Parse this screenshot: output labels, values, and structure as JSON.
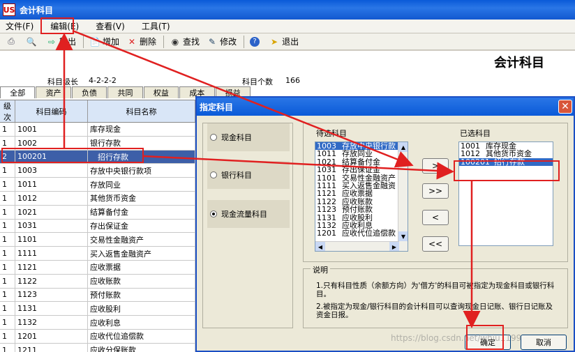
{
  "app": {
    "logo": "US",
    "title": "会计科目"
  },
  "menu": [
    "文件(F)",
    "编辑(E)",
    "查看(V)",
    "工具(T)"
  ],
  "toolbar": [
    {
      "icon": "print-icon",
      "label": ""
    },
    {
      "icon": "preview-icon",
      "label": ""
    },
    {
      "icon": "output-icon",
      "label": "输出"
    },
    {
      "icon": "add-icon",
      "label": "增加"
    },
    {
      "icon": "delete-icon",
      "label": "删除"
    },
    {
      "icon": "binoculars-icon",
      "label": "查找"
    },
    {
      "icon": "edit-icon",
      "label": "修改"
    },
    {
      "icon": "help-icon",
      "label": ""
    },
    {
      "icon": "exit-icon",
      "label": "退出"
    }
  ],
  "doc": {
    "title": "会计科目",
    "level_label": "科目级长",
    "level_value": "4-2-2-2",
    "count_label": "科目个数",
    "count_value": "166"
  },
  "tabs": [
    "全部",
    "资产",
    "负债",
    "共同",
    "权益",
    "成本",
    "损益"
  ],
  "grid": {
    "headers": [
      "级次",
      "科目编码",
      "科目名称"
    ],
    "rows": [
      [
        "1",
        "1001",
        "库存现金"
      ],
      [
        "1",
        "1002",
        "银行存款"
      ],
      [
        "2",
        "100201",
        "招行存款"
      ],
      [
        "1",
        "1003",
        "存放中央银行款项"
      ],
      [
        "1",
        "1011",
        "存放同业"
      ],
      [
        "1",
        "1012",
        "其他货币资金"
      ],
      [
        "1",
        "1021",
        "结算备付金"
      ],
      [
        "1",
        "1031",
        "存出保证金"
      ],
      [
        "1",
        "1101",
        "交易性金融资产"
      ],
      [
        "1",
        "1111",
        "买入返售金融资产"
      ],
      [
        "1",
        "1121",
        "应收票据"
      ],
      [
        "1",
        "1122",
        "应收账款"
      ],
      [
        "1",
        "1123",
        "预付账款"
      ],
      [
        "1",
        "1131",
        "应收股利"
      ],
      [
        "1",
        "1132",
        "应收利息"
      ],
      [
        "1",
        "1201",
        "应收代位追偿款"
      ],
      [
        "1",
        "1211",
        "应收分保账款"
      ]
    ],
    "selected_index": 2
  },
  "dialog": {
    "title": "指定科目",
    "close": "✕",
    "radios": [
      {
        "label": "现金科目",
        "checked": false
      },
      {
        "label": "银行科目",
        "checked": false
      },
      {
        "label": "现金流量科目",
        "checked": true
      }
    ],
    "pending_label": "待选科目",
    "pending": [
      [
        "1003",
        "存放中央银行款"
      ],
      [
        "1011",
        "存放同业"
      ],
      [
        "1021",
        "结算备付金"
      ],
      [
        "1031",
        "存出保证金"
      ],
      [
        "1101",
        "交易性金融资产"
      ],
      [
        "1111",
        "买入返售金融资"
      ],
      [
        "1121",
        "应收票据"
      ],
      [
        "1122",
        "应收账款"
      ],
      [
        "1123",
        "预付账款"
      ],
      [
        "1131",
        "应收股利"
      ],
      [
        "1132",
        "应收利息"
      ],
      [
        "1201",
        "应收代位追偿款"
      ]
    ],
    "selected_label": "已选科目",
    "selected": [
      [
        "1001",
        "库存现金"
      ],
      [
        "1012",
        "其他货币资金"
      ],
      [
        "100201",
        "招行存款"
      ]
    ],
    "move_buttons": [
      ">",
      ">>",
      "<",
      "<<"
    ],
    "desc_title": "说明",
    "desc_1": "1.只有科目性质（余额方向）为'借方'的科目可被指定为现金科目或银行科目。",
    "desc_2": "2.被指定为现金/银行科目的会计科目可以查询现金日记账、银行日记账及资金日报。",
    "ok": "确定",
    "cancel": "取消"
  },
  "watermark": "https://blog.csdn.net/whiu1199",
  "annotation_color": "#e02020"
}
